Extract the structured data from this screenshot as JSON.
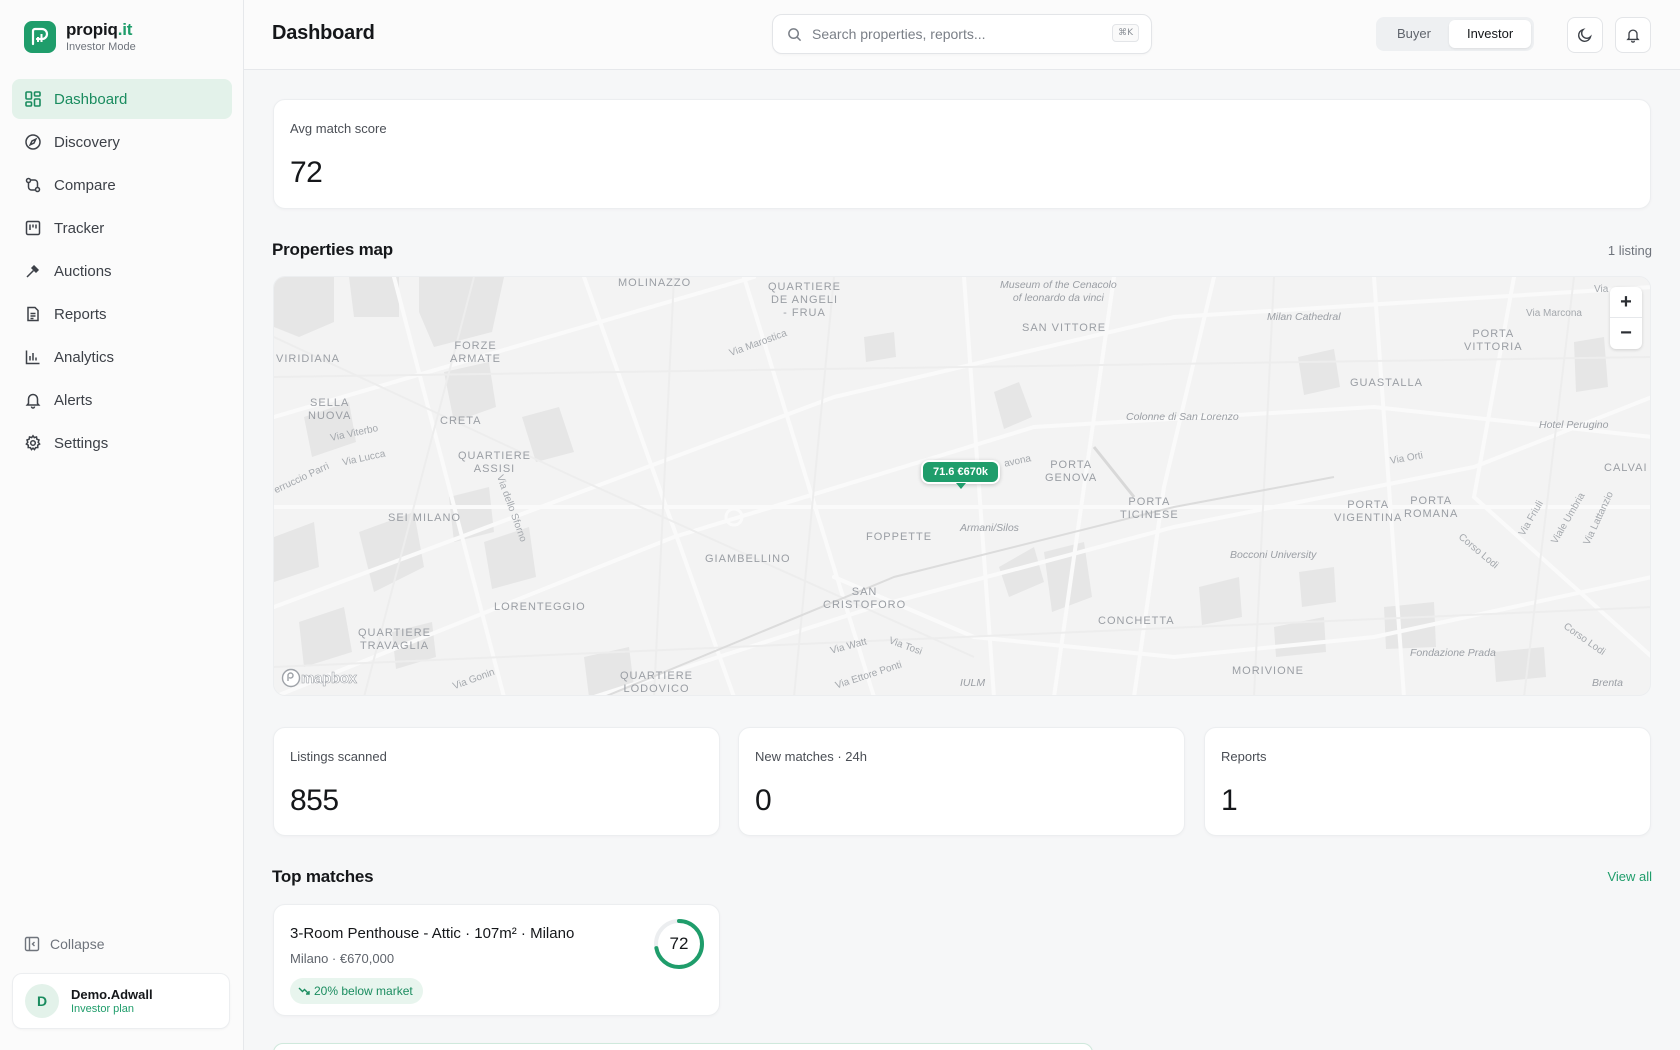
{
  "brand": {
    "name": "propiq",
    "tld": ".it",
    "mode": "Investor Mode"
  },
  "sidebar": {
    "items": [
      {
        "label": "Dashboard",
        "icon": "dashboard-icon",
        "active": true
      },
      {
        "label": "Discovery",
        "icon": "compass-icon"
      },
      {
        "label": "Compare",
        "icon": "compare-icon"
      },
      {
        "label": "Tracker",
        "icon": "kanban-icon"
      },
      {
        "label": "Auctions",
        "icon": "gavel-icon"
      },
      {
        "label": "Reports",
        "icon": "document-icon"
      },
      {
        "label": "Analytics",
        "icon": "bar-chart-icon"
      },
      {
        "label": "Alerts",
        "icon": "bell-icon"
      },
      {
        "label": "Settings",
        "icon": "gear-icon"
      }
    ],
    "collapse_label": "Collapse",
    "user": {
      "initial": "D",
      "name": "Demo.Adwall",
      "plan": "Investor plan"
    }
  },
  "header": {
    "title": "Dashboard",
    "search_placeholder": "Search properties, reports...",
    "search_shortcut": "⌘K",
    "modes": [
      "Buyer",
      "Investor"
    ],
    "active_mode": "Investor"
  },
  "stats": {
    "avg_match": {
      "label": "Avg match score",
      "value": "72"
    },
    "listings_scanned": {
      "label": "Listings scanned",
      "value": "855"
    },
    "new_matches": {
      "label": "New matches · 24h",
      "value": "0"
    },
    "reports": {
      "label": "Reports",
      "value": "1"
    }
  },
  "map": {
    "title": "Properties map",
    "count": "1 listing",
    "marker": {
      "score": "71.6",
      "price": "€670k",
      "text": "71.6  €670k"
    },
    "attribution": "mapbox",
    "labels": {
      "molinazzo": "MOLINAZZO",
      "quartiere_de_angeli": "QUARTIERE\nDE ANGELI\n- FRUA",
      "cenacolo": "Museum of the Cenacolo\nof leonardo da vinci",
      "san_vittore": "SAN VITTORE",
      "milan_cathedral": "Milan Cathedral",
      "via_marcona": "Via Marcona",
      "porta_vittoria": "PORTA\nVITTORIA",
      "viridiana": "VIRIDIANA",
      "forze_armate": "FORZE\nARMATE",
      "via_marostica": "Via Marostica",
      "guastalla": "GUASTALLA",
      "sella_nuova": "SELLA\nNUOVA",
      "via_viterbo": "Via Viterbo",
      "creta": "CRETA",
      "colonne": "Colonne di San Lorenzo",
      "hotel_perugino": "Hotel Perugino",
      "via_lucca": "Via Lucca",
      "quartiere_assisi": "QUARTIERE\nASSISI",
      "avona": "avona",
      "porta_genova": "PORTA\nGENOVA",
      "via_orti": "Via Orti",
      "calvai": "CALVAI",
      "ferruccio_parri": "erruccio Parri",
      "via_dello_sforno": "Via dello Sforno",
      "porta_ticinese": "PORTA\nTICINESE",
      "porta_vigentina": "PORTA\nVIGENTINA",
      "porta_romana": "PORTA\nROMANA",
      "sei_milano": "SEI MILANO",
      "armani_silos": "Armani/Silos",
      "foppette": "FOPPETTE",
      "via_friuli": "Via Friuli",
      "viale_umbria": "Viale Umbria",
      "via_lattanzio": "Via Lattanzio",
      "giambellino": "GIAMBELLINO",
      "bocconi": "Bocconi University",
      "corso_lodi": "Corso Lodi",
      "san_cristoforo": "SAN\nCRISTOFORO",
      "lorenteggio": "LORENTEGGIO",
      "conchetta": "CONCHETTA",
      "quartiere_travaglia": "QUARTIERE\nTRAVAGLIA",
      "via_watt": "Via Watt",
      "via_tosi": "Via Tosi",
      "fondazione_prada": "Fondazione Prada",
      "corso_lodi_2": "Corso Lodi",
      "via_gonin": "Via Gonin",
      "quartiere_lodovico": "QUARTIERE\nLODOVICO",
      "via_ettore_ponti": "Via Ettore Ponti",
      "iulm": "IULM",
      "morivione": "MORIVIONE",
      "brenta": "Brenta",
      "via_top": "Via"
    }
  },
  "top_matches": {
    "title": "Top matches",
    "view_all": "View all",
    "items": [
      {
        "title": "3-Room Penthouse - Attic · 107m² · Milano",
        "subtitle": "Milano · €670,000",
        "badge": "20% below market",
        "score": "72",
        "score_fraction": 0.72
      }
    ]
  },
  "colors": {
    "accent": "#1f9d6b",
    "accent_soft": "#e3f2ea"
  }
}
